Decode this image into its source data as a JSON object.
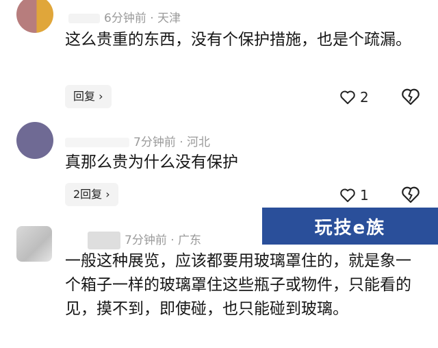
{
  "comments": [
    {
      "time": "6分钟前",
      "location": "天津",
      "text": "这么贵重的东西，没有个保护措施，也是个疏漏。",
      "reply_label": "回复",
      "likes": "2"
    },
    {
      "time": "7分钟前",
      "location": "河北",
      "text": "真那么贵为什么没有保护",
      "reply_label": "2回复",
      "likes": "1"
    },
    {
      "time": "7分钟前",
      "location": "广东",
      "text": "一般这种展览，应该都要用玻璃罩住的，就是象一个箱子一样的玻璃罩住这些瓶子或物件，只能看的见，摸不到，即使碰，也只能碰到玻璃。"
    }
  ],
  "separator": "·",
  "watermark": {
    "text": "玩技e族"
  },
  "colors": {
    "watermark_bg": "#2a4f9a",
    "meta_text": "#9a9a9a"
  }
}
